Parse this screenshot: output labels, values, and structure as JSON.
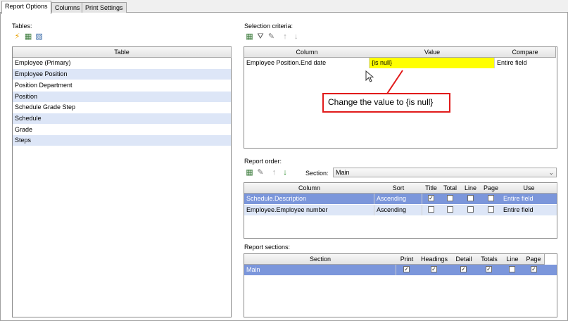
{
  "tabs": [
    "Report Options",
    "Columns",
    "Print Settings"
  ],
  "tables": {
    "label": "Tables:",
    "header": "Table",
    "rows": [
      "Employee (Primary)",
      "Employee Position",
      "Position Department",
      "Position",
      "Schedule Grade Step",
      "Schedule",
      "Grade",
      "Steps"
    ]
  },
  "selection": {
    "label": "Selection criteria:",
    "headers": [
      "Column",
      "Value",
      "Compare"
    ],
    "row": {
      "column": "Employee Position.End date",
      "value": "{is null}",
      "compare": "Entire field"
    },
    "highlight_color": "#ffff00"
  },
  "callout": {
    "text": "Change the value to {is null}",
    "color": "#e11b1b"
  },
  "report_order": {
    "label": "Report order:",
    "section_label": "Section:",
    "section_value": "Main",
    "headers": [
      "Column",
      "Sort",
      "Title",
      "Total",
      "Line",
      "Page",
      "Use"
    ],
    "rows": [
      {
        "column": "Schedule.Description",
        "sort": "Ascending",
        "title": true,
        "total": false,
        "line": false,
        "page": false,
        "use": "Entire field"
      },
      {
        "column": "Employee.Employee number",
        "sort": "Ascending",
        "title": false,
        "total": false,
        "line": false,
        "page": false,
        "use": "Entire field"
      }
    ]
  },
  "report_sections": {
    "label": "Report sections:",
    "headers": [
      "Section",
      "Print",
      "Headings",
      "Detail",
      "Totals",
      "Line",
      "Page"
    ],
    "rows": [
      {
        "section": "Main",
        "print": true,
        "headings": true,
        "detail": true,
        "totals": true,
        "line": false,
        "page": true
      }
    ]
  },
  "check_mark": "✓"
}
